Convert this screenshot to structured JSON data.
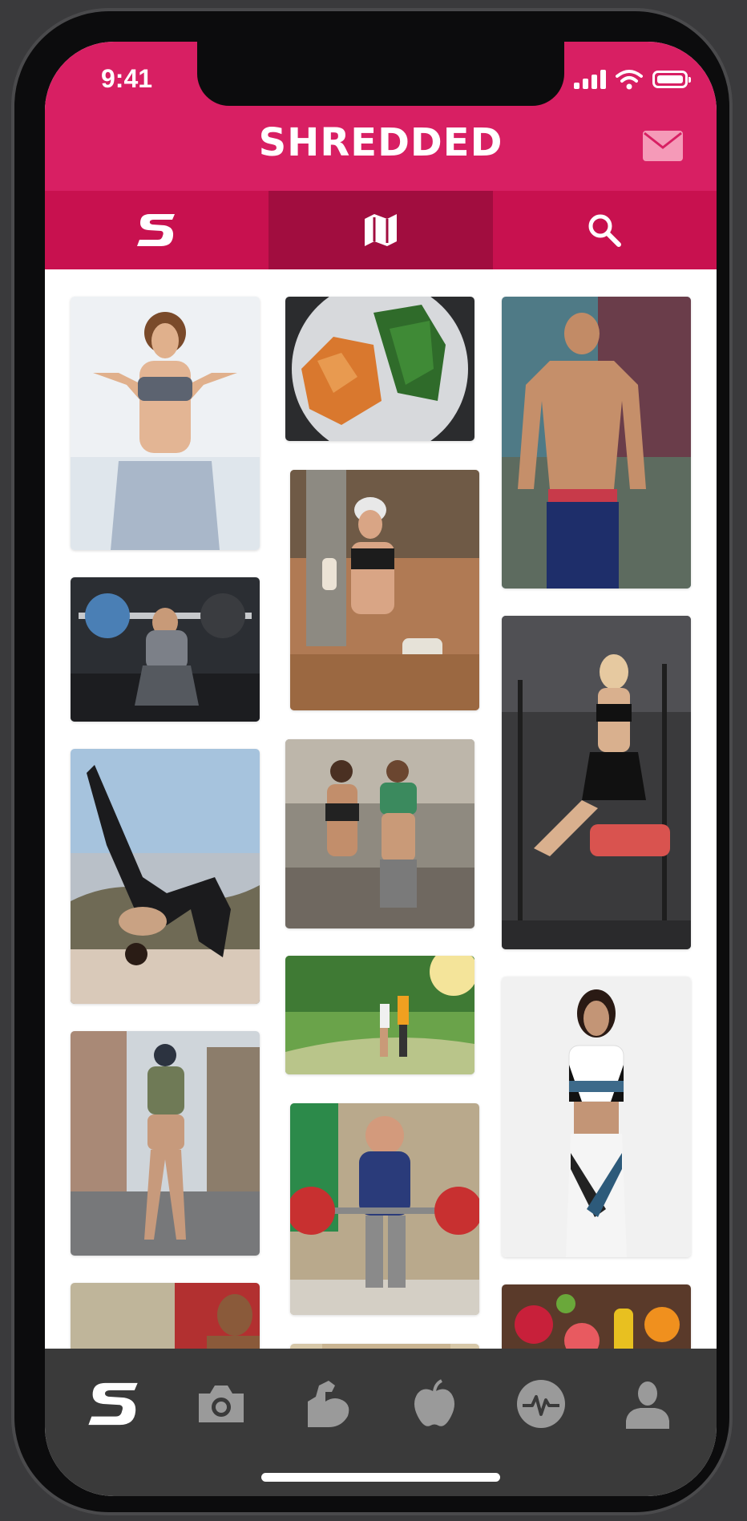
{
  "status_bar": {
    "time": "9:41"
  },
  "header": {
    "title": "SHREDDED",
    "icons": [
      "mail-icon"
    ]
  },
  "tabs": [
    {
      "name": "shredded-feed",
      "icon": "shredded-s-icon",
      "active": false
    },
    {
      "name": "map",
      "icon": "map-icon",
      "active": true
    },
    {
      "name": "search",
      "icon": "search-icon",
      "active": false
    }
  ],
  "grid": {
    "columns": [
      [
        "fitness-woman-peace-sign",
        "man-barbell-squat",
        "woman-yoga-backbend",
        "woman-fitness-cap",
        "bodybuilder-partial"
      ],
      [
        "salmon-vegetable-plate",
        "woman-protein-shake",
        "couple-gym-selfie",
        "couple-jogging-park",
        "powerlifter-deadlift",
        "partial-photo"
      ],
      [
        "shirtless-man-abs",
        "woman-gym-bench",
        "sports-bra-leggings-model",
        "fruits-vegetables"
      ]
    ]
  },
  "bottom_nav": {
    "items": [
      "shredded-s-icon",
      "camera-icon",
      "muscle-arm-icon",
      "apple-icon",
      "heartbeat-icon",
      "profile-icon"
    ]
  },
  "colors": {
    "header": "#d81f63",
    "tabbar": "#c8114f",
    "tab_active": "#a10d3f",
    "bottom_nav": "#3a3a3a"
  }
}
